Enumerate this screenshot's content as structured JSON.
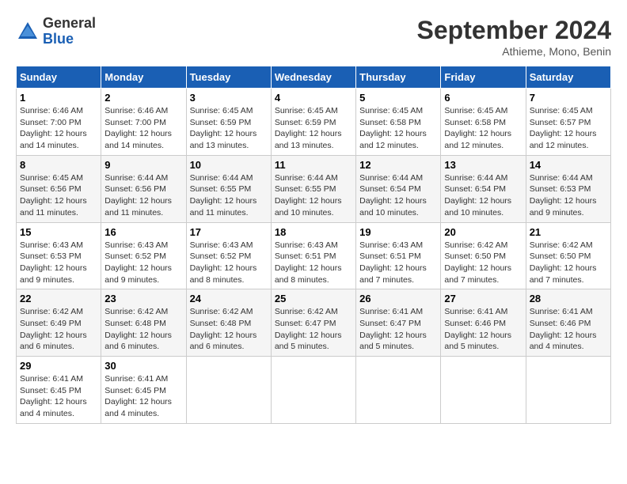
{
  "header": {
    "logo_general": "General",
    "logo_blue": "Blue",
    "month_title": "September 2024",
    "subtitle": "Athieme, Mono, Benin"
  },
  "days_of_week": [
    "Sunday",
    "Monday",
    "Tuesday",
    "Wednesday",
    "Thursday",
    "Friday",
    "Saturday"
  ],
  "weeks": [
    [
      {
        "day": "1",
        "sunrise": "6:46 AM",
        "sunset": "7:00 PM",
        "daylight": "12 hours and 14 minutes."
      },
      {
        "day": "2",
        "sunrise": "6:46 AM",
        "sunset": "7:00 PM",
        "daylight": "12 hours and 14 minutes."
      },
      {
        "day": "3",
        "sunrise": "6:45 AM",
        "sunset": "6:59 PM",
        "daylight": "12 hours and 13 minutes."
      },
      {
        "day": "4",
        "sunrise": "6:45 AM",
        "sunset": "6:59 PM",
        "daylight": "12 hours and 13 minutes."
      },
      {
        "day": "5",
        "sunrise": "6:45 AM",
        "sunset": "6:58 PM",
        "daylight": "12 hours and 12 minutes."
      },
      {
        "day": "6",
        "sunrise": "6:45 AM",
        "sunset": "6:58 PM",
        "daylight": "12 hours and 12 minutes."
      },
      {
        "day": "7",
        "sunrise": "6:45 AM",
        "sunset": "6:57 PM",
        "daylight": "12 hours and 12 minutes."
      }
    ],
    [
      {
        "day": "8",
        "sunrise": "6:45 AM",
        "sunset": "6:56 PM",
        "daylight": "12 hours and 11 minutes."
      },
      {
        "day": "9",
        "sunrise": "6:44 AM",
        "sunset": "6:56 PM",
        "daylight": "12 hours and 11 minutes."
      },
      {
        "day": "10",
        "sunrise": "6:44 AM",
        "sunset": "6:55 PM",
        "daylight": "12 hours and 11 minutes."
      },
      {
        "day": "11",
        "sunrise": "6:44 AM",
        "sunset": "6:55 PM",
        "daylight": "12 hours and 10 minutes."
      },
      {
        "day": "12",
        "sunrise": "6:44 AM",
        "sunset": "6:54 PM",
        "daylight": "12 hours and 10 minutes."
      },
      {
        "day": "13",
        "sunrise": "6:44 AM",
        "sunset": "6:54 PM",
        "daylight": "12 hours and 10 minutes."
      },
      {
        "day": "14",
        "sunrise": "6:44 AM",
        "sunset": "6:53 PM",
        "daylight": "12 hours and 9 minutes."
      }
    ],
    [
      {
        "day": "15",
        "sunrise": "6:43 AM",
        "sunset": "6:53 PM",
        "daylight": "12 hours and 9 minutes."
      },
      {
        "day": "16",
        "sunrise": "6:43 AM",
        "sunset": "6:52 PM",
        "daylight": "12 hours and 9 minutes."
      },
      {
        "day": "17",
        "sunrise": "6:43 AM",
        "sunset": "6:52 PM",
        "daylight": "12 hours and 8 minutes."
      },
      {
        "day": "18",
        "sunrise": "6:43 AM",
        "sunset": "6:51 PM",
        "daylight": "12 hours and 8 minutes."
      },
      {
        "day": "19",
        "sunrise": "6:43 AM",
        "sunset": "6:51 PM",
        "daylight": "12 hours and 7 minutes."
      },
      {
        "day": "20",
        "sunrise": "6:42 AM",
        "sunset": "6:50 PM",
        "daylight": "12 hours and 7 minutes."
      },
      {
        "day": "21",
        "sunrise": "6:42 AM",
        "sunset": "6:50 PM",
        "daylight": "12 hours and 7 minutes."
      }
    ],
    [
      {
        "day": "22",
        "sunrise": "6:42 AM",
        "sunset": "6:49 PM",
        "daylight": "12 hours and 6 minutes."
      },
      {
        "day": "23",
        "sunrise": "6:42 AM",
        "sunset": "6:48 PM",
        "daylight": "12 hours and 6 minutes."
      },
      {
        "day": "24",
        "sunrise": "6:42 AM",
        "sunset": "6:48 PM",
        "daylight": "12 hours and 6 minutes."
      },
      {
        "day": "25",
        "sunrise": "6:42 AM",
        "sunset": "6:47 PM",
        "daylight": "12 hours and 5 minutes."
      },
      {
        "day": "26",
        "sunrise": "6:41 AM",
        "sunset": "6:47 PM",
        "daylight": "12 hours and 5 minutes."
      },
      {
        "day": "27",
        "sunrise": "6:41 AM",
        "sunset": "6:46 PM",
        "daylight": "12 hours and 5 minutes."
      },
      {
        "day": "28",
        "sunrise": "6:41 AM",
        "sunset": "6:46 PM",
        "daylight": "12 hours and 4 minutes."
      }
    ],
    [
      {
        "day": "29",
        "sunrise": "6:41 AM",
        "sunset": "6:45 PM",
        "daylight": "12 hours and 4 minutes."
      },
      {
        "day": "30",
        "sunrise": "6:41 AM",
        "sunset": "6:45 PM",
        "daylight": "12 hours and 4 minutes."
      },
      null,
      null,
      null,
      null,
      null
    ]
  ]
}
